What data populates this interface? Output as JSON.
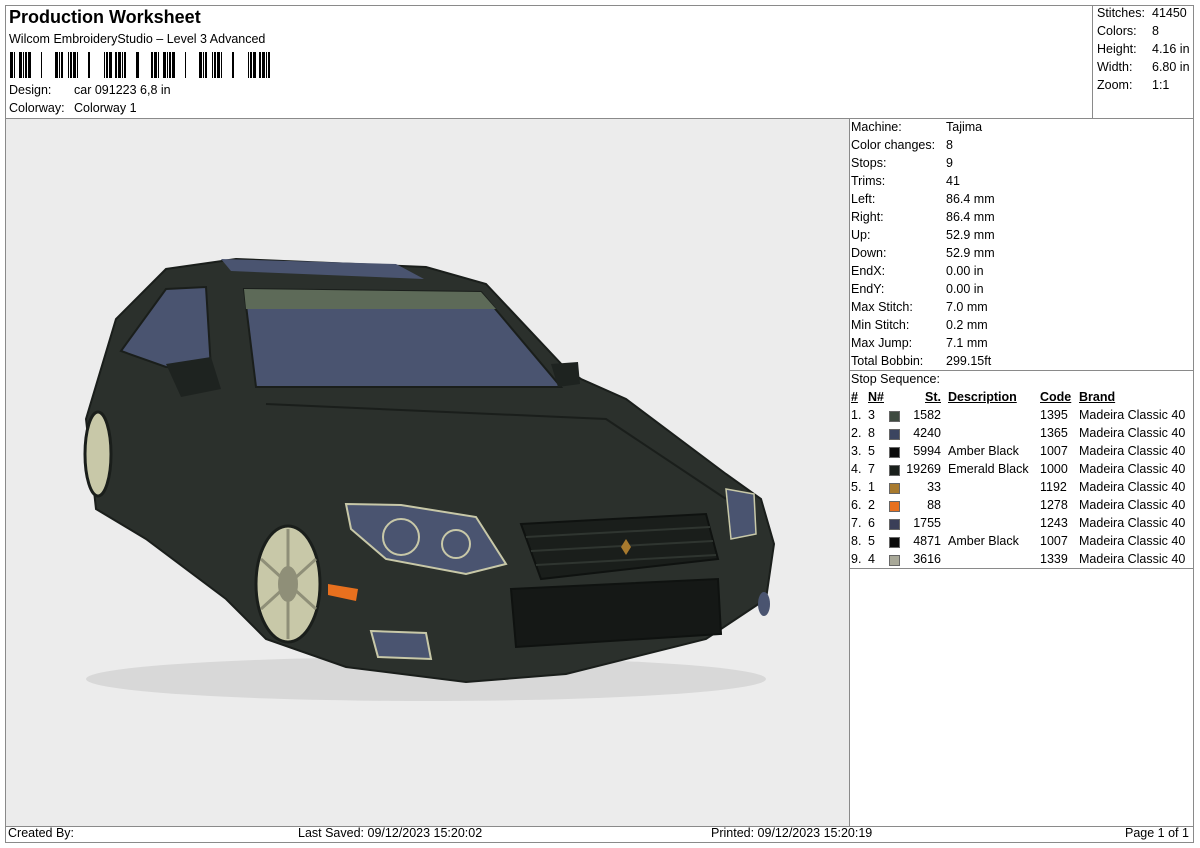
{
  "header": {
    "title": "Production Worksheet",
    "subtitle": "Wilcom EmbroideryStudio – Level 3 Advanced",
    "design_label": "Design:",
    "design_value": "car 091223 6,8 in",
    "colorway_label": "Colorway:",
    "colorway_value": "Colorway 1"
  },
  "stats": [
    {
      "label": "Stitches:",
      "value": "41450"
    },
    {
      "label": "Colors:",
      "value": "8"
    },
    {
      "label": "Height:",
      "value": "4.16 in"
    },
    {
      "label": "Width:",
      "value": "6.80 in"
    },
    {
      "label": "Zoom:",
      "value": "1:1"
    }
  ],
  "machine_info": [
    {
      "label": "Machine:",
      "value": "Tajima"
    },
    {
      "label": "Color changes:",
      "value": "8"
    },
    {
      "label": "Stops:",
      "value": "9"
    },
    {
      "label": "Trims:",
      "value": "41"
    },
    {
      "label": "Left:",
      "value": "86.4 mm"
    },
    {
      "label": "Right:",
      "value": "86.4 mm"
    },
    {
      "label": "Up:",
      "value": "52.9 mm"
    },
    {
      "label": "Down:",
      "value": "52.9 mm"
    },
    {
      "label": "EndX:",
      "value": "0.00 in"
    },
    {
      "label": "EndY:",
      "value": "0.00 in"
    },
    {
      "label": "Max Stitch:",
      "value": "7.0 mm"
    },
    {
      "label": "Min Stitch:",
      "value": "0.2 mm"
    },
    {
      "label": "Max Jump:",
      "value": "7.1 mm"
    },
    {
      "label": "Total Bobbin:",
      "value": "299.15ft"
    }
  ],
  "stop_sequence": {
    "title": "Stop Sequence:",
    "columns": {
      "num": "#",
      "n": "N#",
      "st": "St.",
      "desc": "Description",
      "code": "Code",
      "brand": "Brand"
    },
    "rows": [
      {
        "num": "1.",
        "n": "3",
        "color": "#3e4a40",
        "st": "1582",
        "desc": "",
        "code": "1395",
        "brand": "Madeira Classic 40"
      },
      {
        "num": "2.",
        "n": "8",
        "color": "#3b4560",
        "st": "4240",
        "desc": "",
        "code": "1365",
        "brand": "Madeira Classic 40"
      },
      {
        "num": "3.",
        "n": "5",
        "color": "#0a0a0a",
        "st": "5994",
        "desc": "Amber Black",
        "code": "1007",
        "brand": "Madeira Classic 40"
      },
      {
        "num": "4.",
        "n": "7",
        "color": "#1a201c",
        "st": "19269",
        "desc": "Emerald Black",
        "code": "1000",
        "brand": "Madeira Classic 40"
      },
      {
        "num": "5.",
        "n": "1",
        "color": "#a87a2e",
        "st": "33",
        "desc": "",
        "code": "1192",
        "brand": "Madeira Classic 40"
      },
      {
        "num": "6.",
        "n": "2",
        "color": "#e8701e",
        "st": "88",
        "desc": "",
        "code": "1278",
        "brand": "Madeira Classic 40"
      },
      {
        "num": "7.",
        "n": "6",
        "color": "#3a3f58",
        "st": "1755",
        "desc": "",
        "code": "1243",
        "brand": "Madeira Classic 40"
      },
      {
        "num": "8.",
        "n": "5",
        "color": "#0a0a0a",
        "st": "4871",
        "desc": "Amber Black",
        "code": "1007",
        "brand": "Madeira Classic 40"
      },
      {
        "num": "9.",
        "n": "4",
        "color": "#a8a898",
        "st": "3616",
        "desc": "",
        "code": "1339",
        "brand": "Madeira Classic 40"
      }
    ]
  },
  "footer": {
    "created_by": "Created By:",
    "last_saved": "Last Saved: 09/12/2023 15:20:02",
    "printed": "Printed: 09/12/2023 15:20:19",
    "page": "Page 1 of 1"
  },
  "colors": {
    "car_body": "#2b302c",
    "car_glass": "#4a5470",
    "wheel": "#c8c8a8",
    "preview_bg": "#ececec"
  },
  "icons": {
    "barcode": "barcode-graphic",
    "preview": "embroidery-car-preview"
  }
}
